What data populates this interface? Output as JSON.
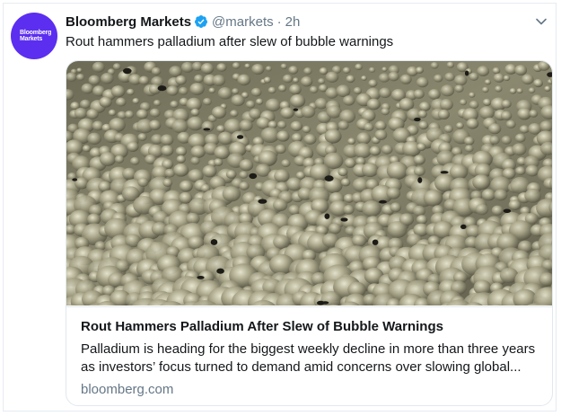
{
  "author": {
    "avatar_text_line1": "Bloomberg",
    "avatar_text_line2": "Markets",
    "display_name": "Bloomberg Markets",
    "handle": "@markets",
    "separator": "·",
    "time": "2h",
    "verified_icon": "verified-badge-icon",
    "avatar_color": "#5c2ef0"
  },
  "tweet": {
    "text": "Rout hammers palladium after slew of bubble warnings"
  },
  "menu_icon": "chevron-down-icon",
  "card": {
    "image_subject": "bubbly-metal-image",
    "title": "Rout Hammers Palladium After Slew of Bubble Warnings",
    "description_line1": "Palladium is heading for the biggest weekly decline in more than three years",
    "description_line2": "as investors’ focus turned to demand amid concerns over slowing global...",
    "domain": "bloomberg.com"
  },
  "colors": {
    "accent_blue": "#1da1f2",
    "secondary_text": "#657786",
    "border": "#e1e8ed"
  }
}
